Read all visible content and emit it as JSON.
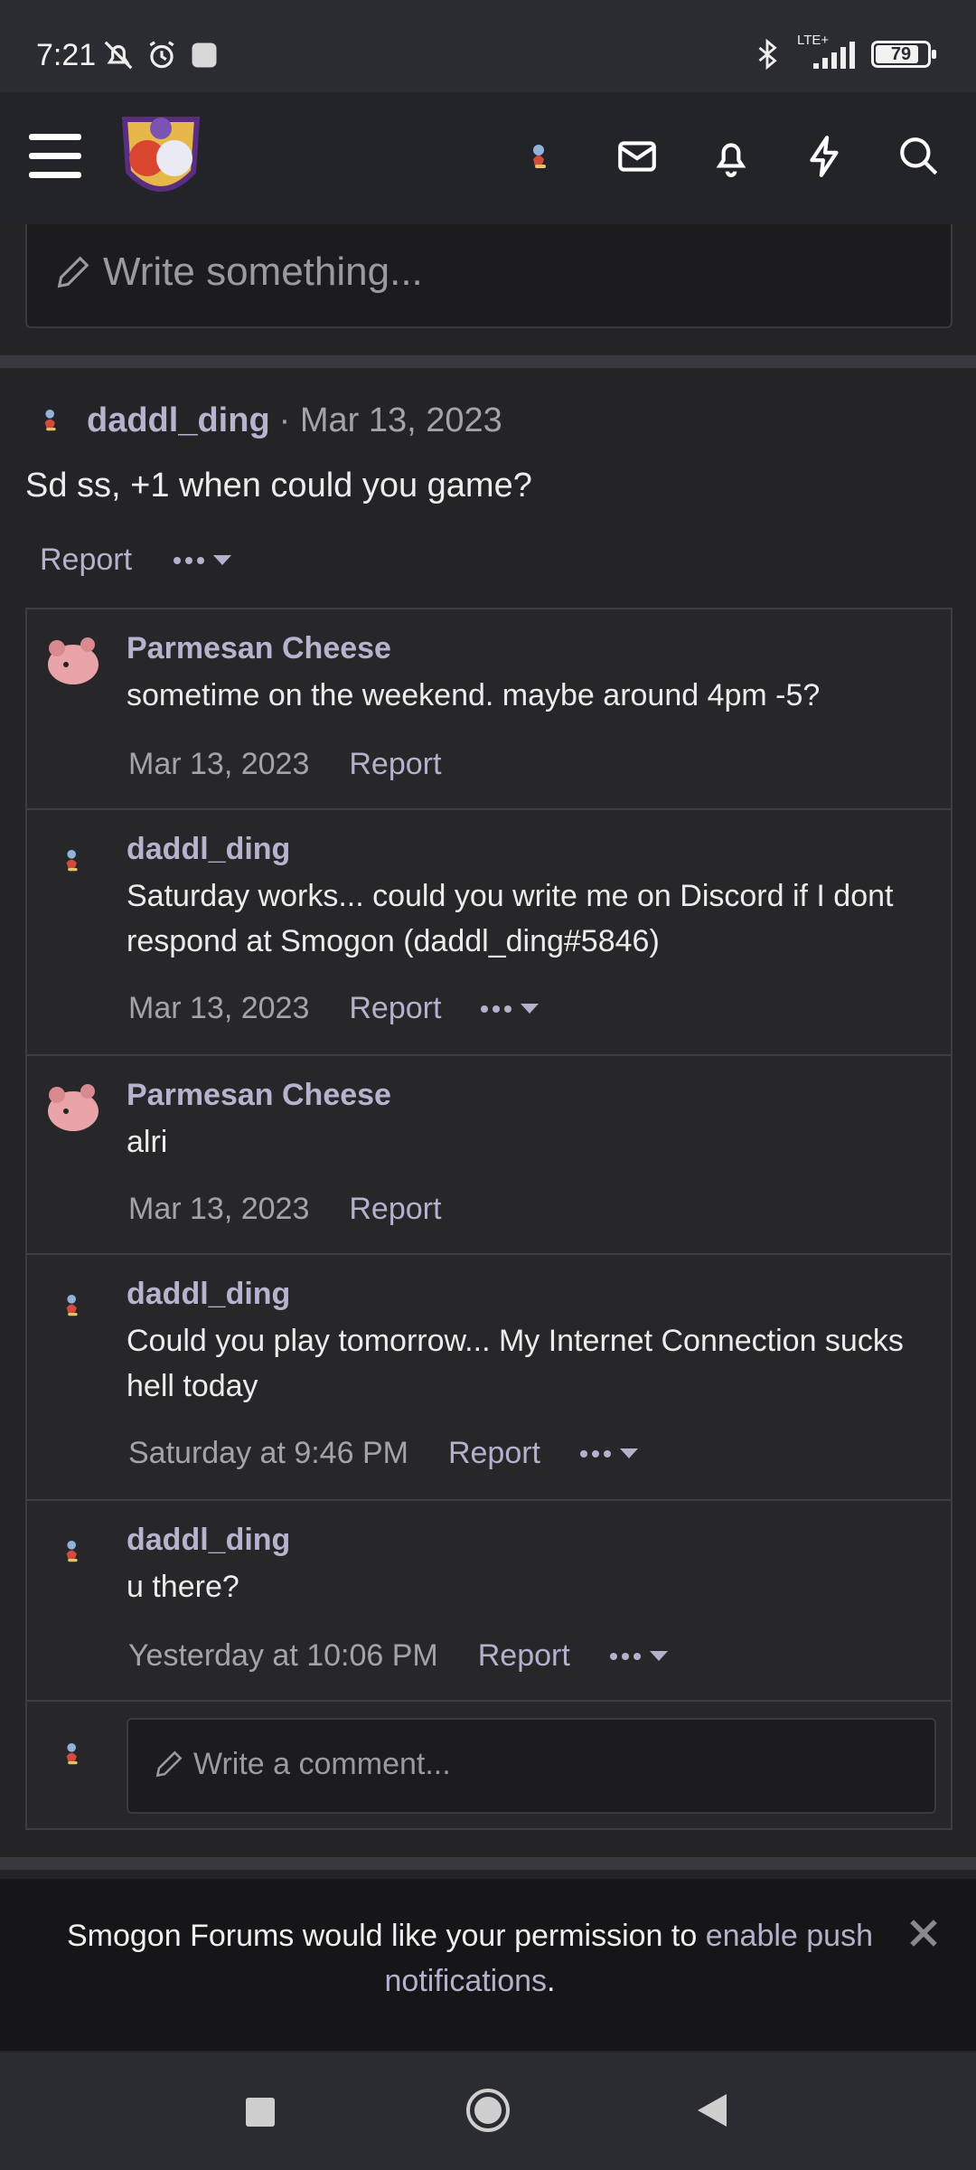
{
  "status_bar": {
    "time": "7:21",
    "network": "LTE+",
    "battery": "79",
    "battery_level": 0.79
  },
  "header": {
    "icons": [
      "menu-icon",
      "site-logo",
      "user-avatar",
      "mail-icon",
      "bell-icon",
      "lightning-icon",
      "search-icon"
    ]
  },
  "composer": {
    "placeholder": "Write something..."
  },
  "post": {
    "user": "daddl_ding",
    "date": "· Mar 13, 2023",
    "body": "Sd ss, +1 when could you game?",
    "report": "Report"
  },
  "comments": [
    {
      "user": "Parmesan Cheese",
      "text": "sometime on the weekend. maybe around 4pm -5?",
      "date": "Mar 13, 2023",
      "report": "Report",
      "has_more": false
    },
    {
      "user": "daddl_ding",
      "text": "Saturday works... could you write me on Discord if I dont respond at Smogon (daddl_ding#5846)",
      "date": "Mar 13, 2023",
      "report": "Report",
      "has_more": true
    },
    {
      "user": "Parmesan Cheese",
      "text": "alri",
      "date": "Mar 13, 2023",
      "report": "Report",
      "has_more": false
    },
    {
      "user": "daddl_ding",
      "text": "Could you play tomorrow... My Internet Connection sucks hell today",
      "date": "Saturday at 9:46 PM",
      "report": "Report",
      "has_more": true
    },
    {
      "user": "daddl_ding",
      "text": "u there?",
      "date": "Yesterday at 10:06 PM",
      "report": "Report",
      "has_more": true
    }
  ],
  "comment_input": {
    "placeholder": "Write a comment..."
  },
  "push_banner": {
    "text_before": "Smogon Forums would like your permission to ",
    "link": "enable push notifications",
    "text_after": "."
  }
}
